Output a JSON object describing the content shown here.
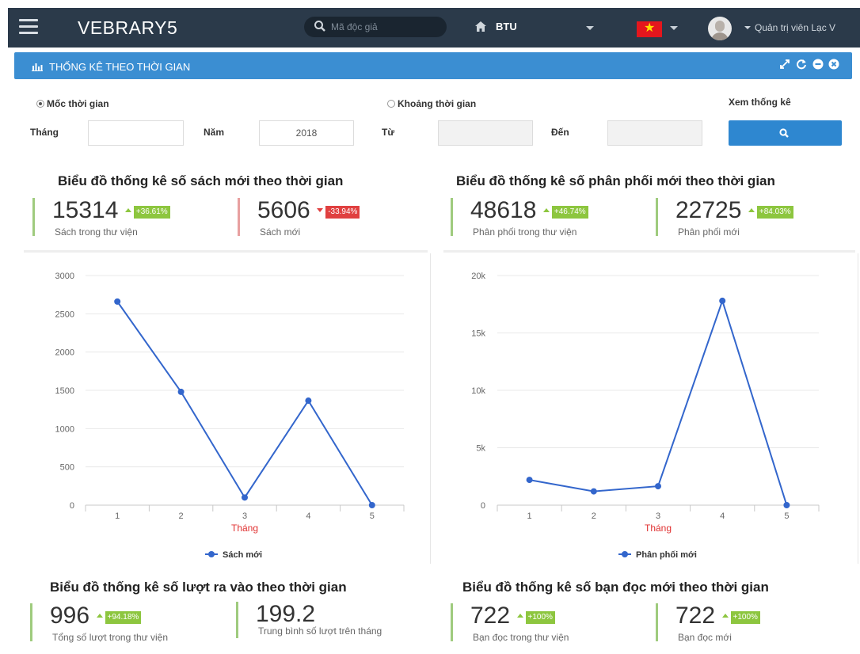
{
  "topbar": {
    "brand": "VEBRARY5",
    "search_placeholder": "Mã độc giả",
    "home_label": "BTU",
    "user_label": "Quản trị viên Lạc V",
    "icons": [
      "menu-icon",
      "search-icon",
      "home-icon",
      "vietnam-flag-icon",
      "avatar"
    ]
  },
  "panel": {
    "title": "THỐNG KÊ THEO THỜI GIAN",
    "tools": [
      "expand-icon",
      "refresh-icon",
      "minimize-icon",
      "close-icon"
    ]
  },
  "filters": {
    "mode_point": "Mốc thời gian",
    "mode_range": "Khoảng thời gian",
    "month_label": "Tháng",
    "month_value": "",
    "year_label": "Năm",
    "year_value": "2018",
    "from_label": "Từ",
    "from_value": "",
    "to_label": "Đến",
    "to_value": "",
    "view_label": "Xem thống kê"
  },
  "sections": {
    "books": {
      "title": "Biểu đồ thống kê số sách mới theo thời gian",
      "stats": [
        {
          "value": "15314",
          "change": "+36.61%",
          "direction": "up",
          "label": "Sách trong thư viện"
        },
        {
          "value": "5606",
          "change": "-33.94%",
          "direction": "down",
          "label": "Sách mới"
        }
      ]
    },
    "distribution": {
      "title": "Biểu đồ thống kê số phân phối mới theo thời gian",
      "stats": [
        {
          "value": "48618",
          "change": "+46.74%",
          "direction": "up",
          "label": "Phân phối trong thư viện"
        },
        {
          "value": "22725",
          "change": "+84.03%",
          "direction": "up",
          "label": "Phân phối mới"
        }
      ]
    },
    "visits": {
      "title": "Biểu đồ thống kê số lượt ra vào theo thời gian",
      "stats": [
        {
          "value": "996",
          "change": "+94.18%",
          "direction": "up",
          "label": "Tổng số lượt trong thư viện"
        },
        {
          "value": "199.2",
          "change": "",
          "direction": "",
          "label": "Trung bình số lượt trên tháng"
        }
      ]
    },
    "readers": {
      "title": "Biểu đồ thống kê số bạn đọc mới theo thời gian",
      "stats": [
        {
          "value": "722",
          "change": "+100%",
          "direction": "up",
          "label": "Bạn đọc trong thư viện"
        },
        {
          "value": "722",
          "change": "+100%",
          "direction": "up",
          "label": "Bạn đọc mới"
        }
      ]
    }
  },
  "colors": {
    "accent": "#3b8ed2",
    "topbar": "#2b3a4a",
    "series": "#3366cc",
    "up": "#8dc63f",
    "down": "#e04040",
    "xlabel": "#e03030"
  },
  "chart_data": [
    {
      "type": "line",
      "x": [
        1,
        2,
        3,
        4,
        5
      ],
      "series": [
        {
          "name": "Sách mới",
          "values": [
            2660,
            1480,
            100,
            1365,
            0
          ]
        }
      ],
      "xlabel": "Tháng",
      "ylabel": "",
      "ylim": [
        0,
        3000
      ],
      "yticks": [
        0,
        500,
        1000,
        1500,
        2000,
        2500,
        3000
      ],
      "ytick_labels": [
        "0",
        "500",
        "1000",
        "1500",
        "2000",
        "2500",
        "3000"
      ],
      "legend": "bottom",
      "grid": true
    },
    {
      "type": "line",
      "x": [
        1,
        2,
        3,
        4,
        5
      ],
      "series": [
        {
          "name": "Phân phối mới",
          "values": [
            2200,
            1200,
            1650,
            17800,
            0
          ]
        }
      ],
      "xlabel": "Tháng",
      "ylabel": "",
      "ylim": [
        0,
        20000
      ],
      "yticks": [
        0,
        5000,
        10000,
        15000,
        20000
      ],
      "ytick_labels": [
        "0",
        "5k",
        "10k",
        "15k",
        "20k"
      ],
      "legend": "bottom",
      "grid": true
    }
  ]
}
